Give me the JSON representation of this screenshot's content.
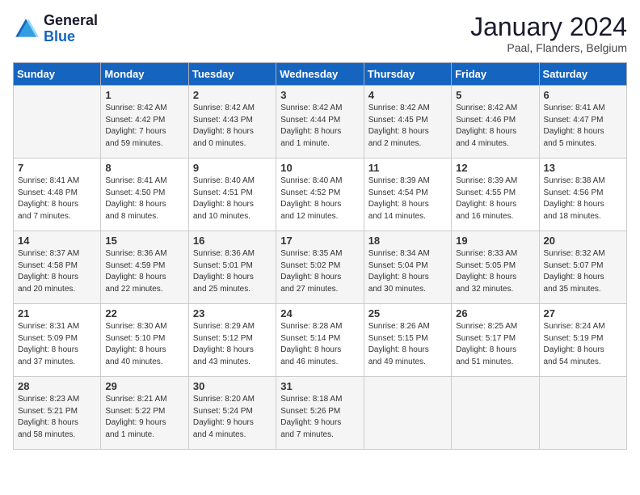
{
  "header": {
    "logo_general": "General",
    "logo_blue": "Blue",
    "month_title": "January 2024",
    "location": "Paal, Flanders, Belgium"
  },
  "days_of_week": [
    "Sunday",
    "Monday",
    "Tuesday",
    "Wednesday",
    "Thursday",
    "Friday",
    "Saturday"
  ],
  "weeks": [
    [
      {
        "day": "",
        "content": ""
      },
      {
        "day": "1",
        "content": "Sunrise: 8:42 AM\nSunset: 4:42 PM\nDaylight: 7 hours\nand 59 minutes."
      },
      {
        "day": "2",
        "content": "Sunrise: 8:42 AM\nSunset: 4:43 PM\nDaylight: 8 hours\nand 0 minutes."
      },
      {
        "day": "3",
        "content": "Sunrise: 8:42 AM\nSunset: 4:44 PM\nDaylight: 8 hours\nand 1 minute."
      },
      {
        "day": "4",
        "content": "Sunrise: 8:42 AM\nSunset: 4:45 PM\nDaylight: 8 hours\nand 2 minutes."
      },
      {
        "day": "5",
        "content": "Sunrise: 8:42 AM\nSunset: 4:46 PM\nDaylight: 8 hours\nand 4 minutes."
      },
      {
        "day": "6",
        "content": "Sunrise: 8:41 AM\nSunset: 4:47 PM\nDaylight: 8 hours\nand 5 minutes."
      }
    ],
    [
      {
        "day": "7",
        "content": "Sunrise: 8:41 AM\nSunset: 4:48 PM\nDaylight: 8 hours\nand 7 minutes."
      },
      {
        "day": "8",
        "content": "Sunrise: 8:41 AM\nSunset: 4:50 PM\nDaylight: 8 hours\nand 8 minutes."
      },
      {
        "day": "9",
        "content": "Sunrise: 8:40 AM\nSunset: 4:51 PM\nDaylight: 8 hours\nand 10 minutes."
      },
      {
        "day": "10",
        "content": "Sunrise: 8:40 AM\nSunset: 4:52 PM\nDaylight: 8 hours\nand 12 minutes."
      },
      {
        "day": "11",
        "content": "Sunrise: 8:39 AM\nSunset: 4:54 PM\nDaylight: 8 hours\nand 14 minutes."
      },
      {
        "day": "12",
        "content": "Sunrise: 8:39 AM\nSunset: 4:55 PM\nDaylight: 8 hours\nand 16 minutes."
      },
      {
        "day": "13",
        "content": "Sunrise: 8:38 AM\nSunset: 4:56 PM\nDaylight: 8 hours\nand 18 minutes."
      }
    ],
    [
      {
        "day": "14",
        "content": "Sunrise: 8:37 AM\nSunset: 4:58 PM\nDaylight: 8 hours\nand 20 minutes."
      },
      {
        "day": "15",
        "content": "Sunrise: 8:36 AM\nSunset: 4:59 PM\nDaylight: 8 hours\nand 22 minutes."
      },
      {
        "day": "16",
        "content": "Sunrise: 8:36 AM\nSunset: 5:01 PM\nDaylight: 8 hours\nand 25 minutes."
      },
      {
        "day": "17",
        "content": "Sunrise: 8:35 AM\nSunset: 5:02 PM\nDaylight: 8 hours\nand 27 minutes."
      },
      {
        "day": "18",
        "content": "Sunrise: 8:34 AM\nSunset: 5:04 PM\nDaylight: 8 hours\nand 30 minutes."
      },
      {
        "day": "19",
        "content": "Sunrise: 8:33 AM\nSunset: 5:05 PM\nDaylight: 8 hours\nand 32 minutes."
      },
      {
        "day": "20",
        "content": "Sunrise: 8:32 AM\nSunset: 5:07 PM\nDaylight: 8 hours\nand 35 minutes."
      }
    ],
    [
      {
        "day": "21",
        "content": "Sunrise: 8:31 AM\nSunset: 5:09 PM\nDaylight: 8 hours\nand 37 minutes."
      },
      {
        "day": "22",
        "content": "Sunrise: 8:30 AM\nSunset: 5:10 PM\nDaylight: 8 hours\nand 40 minutes."
      },
      {
        "day": "23",
        "content": "Sunrise: 8:29 AM\nSunset: 5:12 PM\nDaylight: 8 hours\nand 43 minutes."
      },
      {
        "day": "24",
        "content": "Sunrise: 8:28 AM\nSunset: 5:14 PM\nDaylight: 8 hours\nand 46 minutes."
      },
      {
        "day": "25",
        "content": "Sunrise: 8:26 AM\nSunset: 5:15 PM\nDaylight: 8 hours\nand 49 minutes."
      },
      {
        "day": "26",
        "content": "Sunrise: 8:25 AM\nSunset: 5:17 PM\nDaylight: 8 hours\nand 51 minutes."
      },
      {
        "day": "27",
        "content": "Sunrise: 8:24 AM\nSunset: 5:19 PM\nDaylight: 8 hours\nand 54 minutes."
      }
    ],
    [
      {
        "day": "28",
        "content": "Sunrise: 8:23 AM\nSunset: 5:21 PM\nDaylight: 8 hours\nand 58 minutes."
      },
      {
        "day": "29",
        "content": "Sunrise: 8:21 AM\nSunset: 5:22 PM\nDaylight: 9 hours\nand 1 minute."
      },
      {
        "day": "30",
        "content": "Sunrise: 8:20 AM\nSunset: 5:24 PM\nDaylight: 9 hours\nand 4 minutes."
      },
      {
        "day": "31",
        "content": "Sunrise: 8:18 AM\nSunset: 5:26 PM\nDaylight: 9 hours\nand 7 minutes."
      },
      {
        "day": "",
        "content": ""
      },
      {
        "day": "",
        "content": ""
      },
      {
        "day": "",
        "content": ""
      }
    ]
  ]
}
